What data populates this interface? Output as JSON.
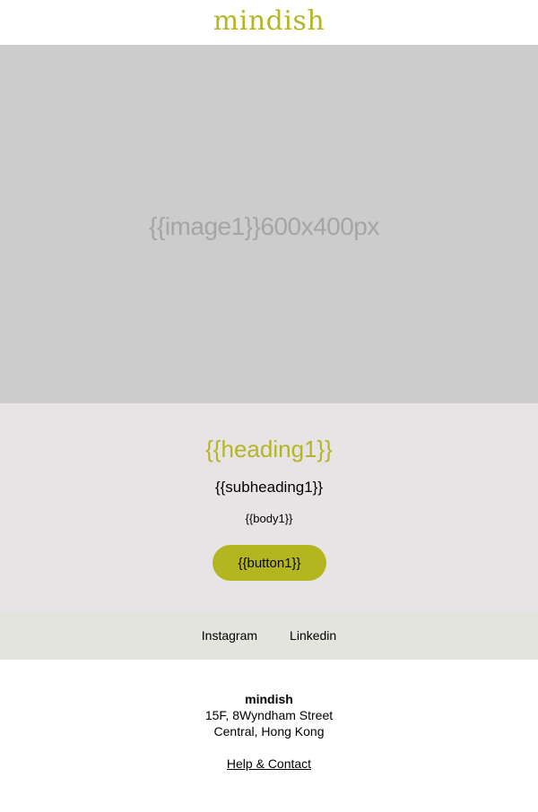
{
  "header": {
    "logo": "mindish"
  },
  "hero": {
    "label": "{{image1}}600x400px"
  },
  "content": {
    "heading": "{{heading1}}",
    "subheading": "{{subheading1}}",
    "body": "{{body1}}",
    "button_label": "{{button1}}"
  },
  "social": {
    "links": [
      {
        "label": "Instagram"
      },
      {
        "label": "Linkedin"
      }
    ]
  },
  "footer": {
    "company": "mindish",
    "address_line1": "15F, 8Wyndham Street",
    "address_line2": "Central, Hong Kong",
    "help_link": "Help & Contact"
  },
  "colors": {
    "accent": "#b4b626",
    "hero_bg": "#cccccc",
    "content_bg": "#e8e3e4",
    "social_bg": "#e3e4de"
  }
}
